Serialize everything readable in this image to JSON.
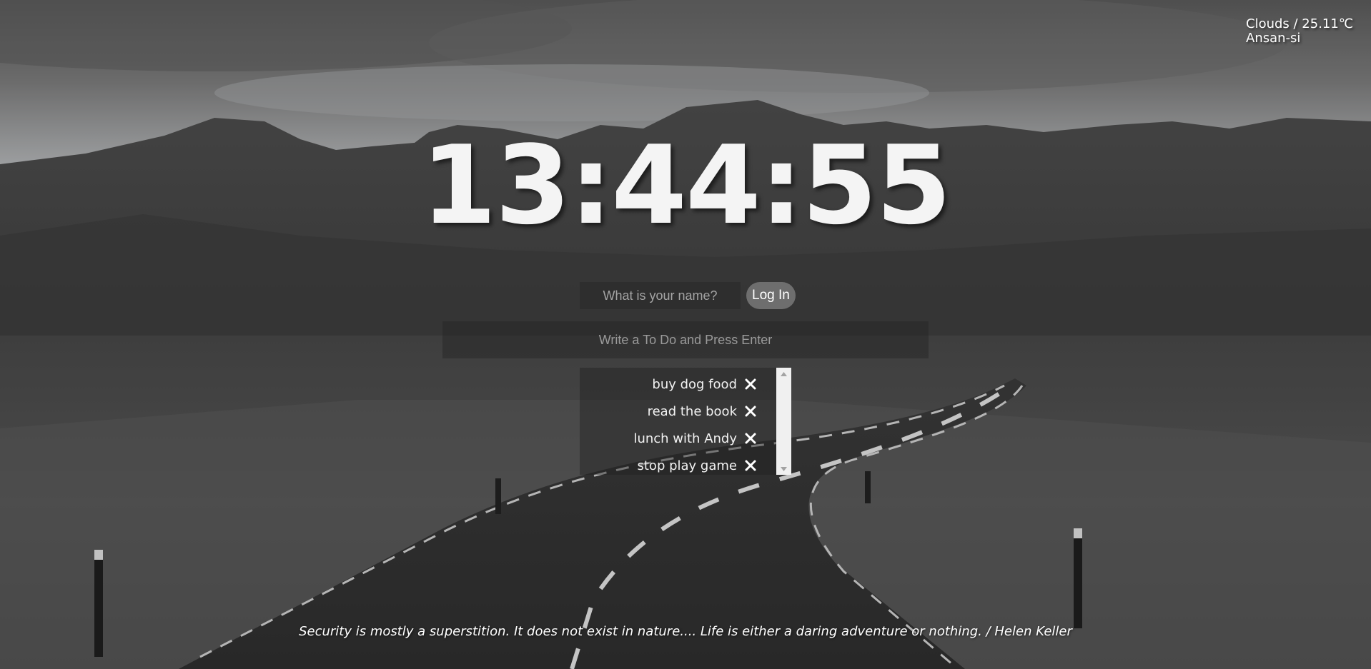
{
  "weather": {
    "condition_temp": "Clouds / 25.11℃",
    "location": "Ansan-si"
  },
  "clock": {
    "time": "13:44:55"
  },
  "login": {
    "placeholder": "What is your name?",
    "button_label": "Log In"
  },
  "todo": {
    "placeholder": "Write a To Do and Press Enter",
    "items": [
      {
        "text": "buy dog food"
      },
      {
        "text": "read the book"
      },
      {
        "text": "lunch with Andy"
      },
      {
        "text": "stop play game"
      }
    ]
  },
  "quote": {
    "text": "Security is mostly a superstition. It does not exist in nature.... Life is either a daring adventure or nothing. / Helen Keller"
  },
  "colors": {
    "text": "#ffffff",
    "button_bg": "#6e6e6e",
    "scrollbar_bg": "#f0f0f0"
  },
  "icons": {
    "delete": "close-x-icon",
    "scroll_up": "triangle-up-icon",
    "scroll_down": "triangle-down-icon"
  }
}
